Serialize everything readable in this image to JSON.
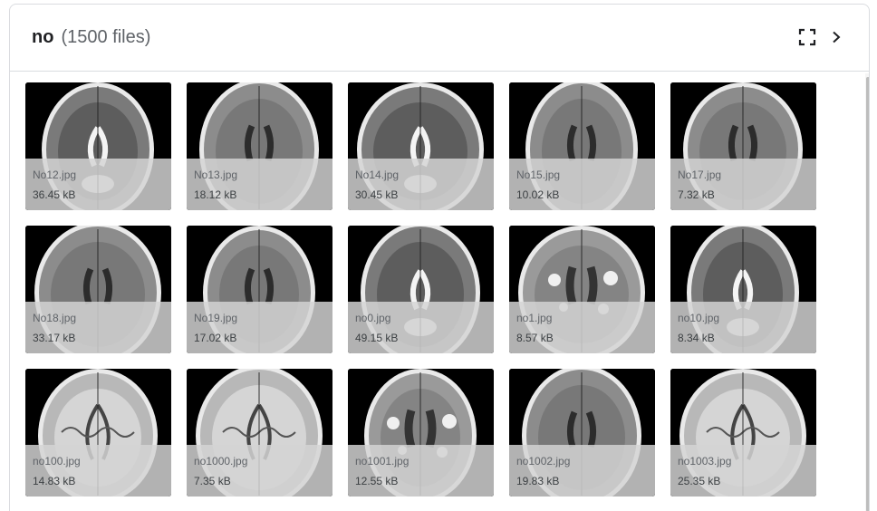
{
  "header": {
    "folder_name": "no",
    "file_count": "(1500 files)",
    "fullscreen_icon": "fullscreen-icon",
    "next_icon": "chevron-right-icon"
  },
  "files": [
    {
      "name": "No12.jpg",
      "size": "36.45 kB"
    },
    {
      "name": "No13.jpg",
      "size": "18.12 kB"
    },
    {
      "name": "No14.jpg",
      "size": "30.45 kB"
    },
    {
      "name": "No15.jpg",
      "size": "10.02 kB"
    },
    {
      "name": "No17.jpg",
      "size": "7.32 kB"
    },
    {
      "name": "No18.jpg",
      "size": "33.17 kB"
    },
    {
      "name": "No19.jpg",
      "size": "17.02 kB"
    },
    {
      "name": "no0.jpg",
      "size": "49.15 kB"
    },
    {
      "name": "no1.jpg",
      "size": "8.57 kB"
    },
    {
      "name": "no10.jpg",
      "size": "8.34 kB"
    },
    {
      "name": "no100.jpg",
      "size": "14.83 kB"
    },
    {
      "name": "no1000.jpg",
      "size": "7.35 kB"
    },
    {
      "name": "no1001.jpg",
      "size": "12.55 kB"
    },
    {
      "name": "no1002.jpg",
      "size": "19.83 kB"
    },
    {
      "name": "no1003.jpg",
      "size": "25.35 kB"
    }
  ]
}
